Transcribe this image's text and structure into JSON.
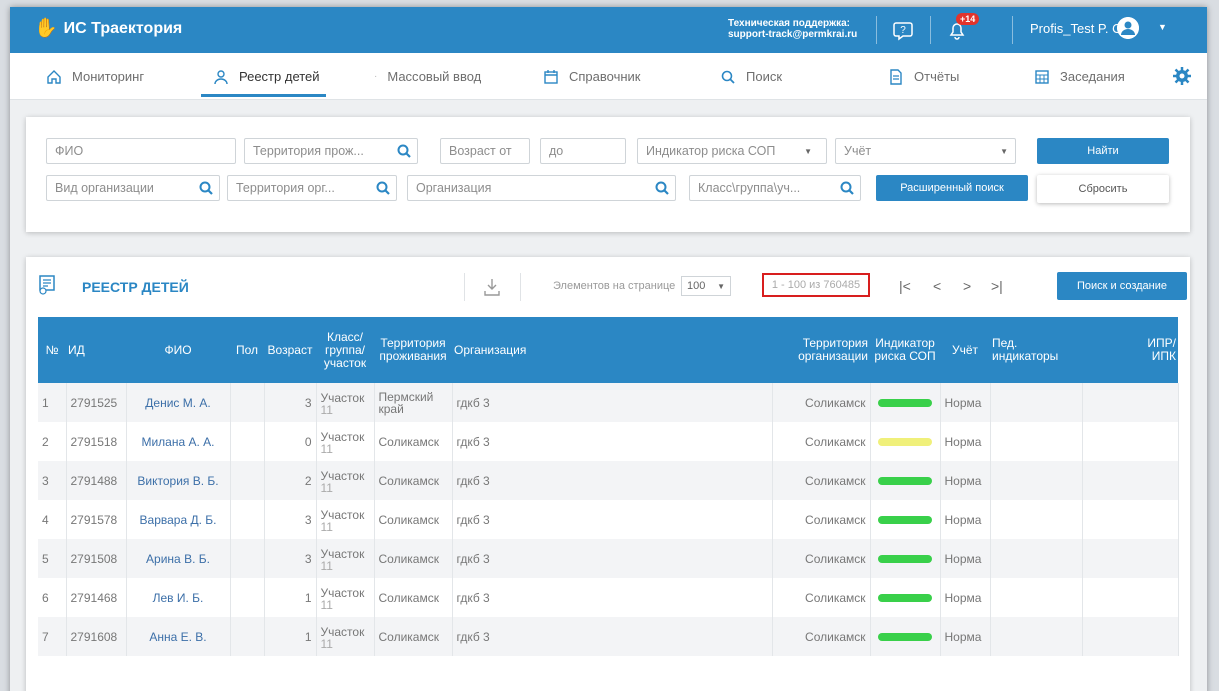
{
  "header": {
    "app_title": "ИС Траектория",
    "support_line1": "Техническая поддержка:",
    "support_line2": "support-track@permkrai.ru",
    "notifications_badge": "+14",
    "user_name": "Profis_Test P. O."
  },
  "nav": {
    "items": [
      {
        "label": "Мониторинг",
        "icon": "home-icon"
      },
      {
        "label": "Реестр детей",
        "icon": "children-icon"
      },
      {
        "label": "Массовый ввод",
        "icon": "dot-icon"
      },
      {
        "label": "Справочник",
        "icon": "calendar-icon"
      },
      {
        "label": "Поиск",
        "icon": "search-icon"
      },
      {
        "label": "Отчёты",
        "icon": "document-icon"
      },
      {
        "label": "Заседания",
        "icon": "calendar-grid-icon"
      }
    ],
    "active": "Реестр детей"
  },
  "filters": {
    "fio_placeholder": "ФИО",
    "territory_residence_placeholder": "Территория прож...",
    "age_from_placeholder": "Возраст от",
    "age_to_placeholder": "до",
    "risk_indicator_placeholder": "Индикатор риска СОП",
    "account_placeholder": "Учёт",
    "org_type_placeholder": "Вид организации",
    "territory_org_placeholder": "Территория орг...",
    "organization_placeholder": "Организация",
    "class_placeholder": "Класс\\группа\\уч...",
    "find_button": "Найти",
    "advanced_button": "Расширенный поиск",
    "reset_button": "Сбросить"
  },
  "registry": {
    "title": "РЕЕСТР ДЕТЕЙ",
    "per_page_label": "Элементов на странице",
    "per_page_value": "100",
    "range_text": "1 - 100 из 760485",
    "create_button": "Поиск и создание",
    "pager": {
      "first": "|<",
      "prev": "<",
      "next": ">",
      "last": ">|"
    },
    "columns": {
      "num": "№",
      "id": "ИД",
      "fio": "ФИО",
      "gender": "Пол",
      "age": "Возраст",
      "class_1": "Класс/",
      "class_2": "группа/",
      "class_3": "участок",
      "territory_res_1": "Территория",
      "territory_res_2": "проживания",
      "organization": "Организация",
      "territory_org_1": "Территория",
      "territory_org_2": "организации",
      "risk_1": "Индикатор",
      "risk_2": "риска СОП",
      "account": "Учёт",
      "ped_1": "Пед.",
      "ped_2": "индикаторы",
      "ipr_1": "ИПР/",
      "ipr_2": "ИПК"
    },
    "rows": [
      {
        "num": "1",
        "id": "2791525",
        "fio": "Денис М. А.",
        "gender": "",
        "age": "3",
        "cls1": "Участок",
        "cls2": "11",
        "territory": "Пермский край",
        "org": "гдкб 3",
        "territory_org": "Соликамск",
        "risk_color": "#39d04a",
        "account": "Норма"
      },
      {
        "num": "2",
        "id": "2791518",
        "fio": "Милана А. А.",
        "gender": "",
        "age": "0",
        "cls1": "Участок",
        "cls2": "11",
        "territory": "Соликамск",
        "org": "гдкб 3",
        "territory_org": "Соликамск",
        "risk_color": "#f0f07a",
        "account": "Норма"
      },
      {
        "num": "3",
        "id": "2791488",
        "fio": "Виктория В. Б.",
        "gender": "",
        "age": "2",
        "cls1": "Участок",
        "cls2": "11",
        "territory": "Соликамск",
        "org": "гдкб 3",
        "territory_org": "Соликамск",
        "risk_color": "#39d04a",
        "account": "Норма"
      },
      {
        "num": "4",
        "id": "2791578",
        "fio": "Варвара Д. Б.",
        "gender": "",
        "age": "3",
        "cls1": "Участок",
        "cls2": "11",
        "territory": "Соликамск",
        "org": "гдкб 3",
        "territory_org": "Соликамск",
        "risk_color": "#39d04a",
        "account": "Норма"
      },
      {
        "num": "5",
        "id": "2791508",
        "fio": "Арина В. Б.",
        "gender": "",
        "age": "3",
        "cls1": "Участок",
        "cls2": "11",
        "territory": "Соликамск",
        "org": "гдкб 3",
        "territory_org": "Соликамск",
        "risk_color": "#39d04a",
        "account": "Норма"
      },
      {
        "num": "6",
        "id": "2791468",
        "fio": "Лев И. Б.",
        "gender": "",
        "age": "1",
        "cls1": "Участок",
        "cls2": "11",
        "territory": "Соликамск",
        "org": "гдкб 3",
        "territory_org": "Соликамск",
        "risk_color": "#39d04a",
        "account": "Норма"
      },
      {
        "num": "7",
        "id": "2791608",
        "fio": "Анна Е. В.",
        "gender": "",
        "age": "1",
        "cls1": "Участок",
        "cls2": "11",
        "territory": "Соликамск",
        "org": "гдкб 3",
        "territory_org": "Соликамск",
        "risk_color": "#39d04a",
        "account": "Норма"
      }
    ]
  },
  "colors": {
    "primary": "#2b87c4",
    "highlight_border": "#d81e1e",
    "risk_green": "#39d04a",
    "risk_yellow": "#f0f07a"
  }
}
